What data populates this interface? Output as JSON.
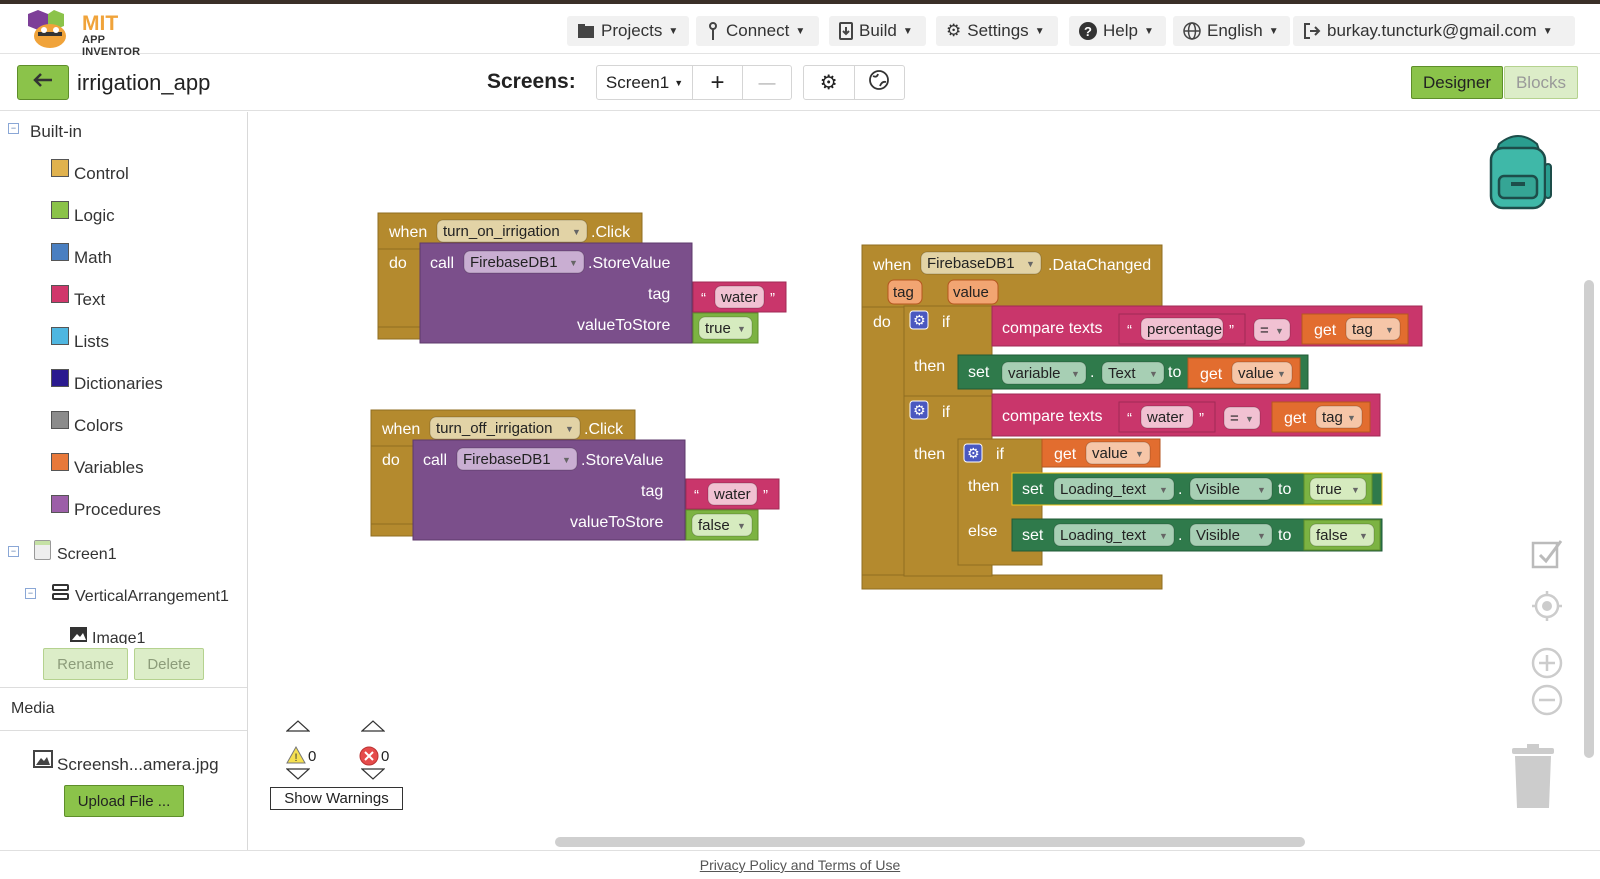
{
  "app": {
    "logo_line1": "MIT",
    "logo_line2": "APP INVENTOR"
  },
  "nav": {
    "projects": "Projects",
    "connect": "Connect",
    "build": "Build",
    "settings": "Settings",
    "help": "Help",
    "language": "English",
    "account": "burkay.tuncturk@gmail.com"
  },
  "toolbar": {
    "project_name": "irrigation_app",
    "screens_label": "Screens:",
    "screen_select": "Screen1",
    "add": "+",
    "remove": "—",
    "designer": "Designer",
    "blocks": "Blocks"
  },
  "sidebar": {
    "builtin": "Built-in",
    "categories": [
      {
        "label": "Control",
        "color": "#e0b24e"
      },
      {
        "label": "Logic",
        "color": "#8bc34a"
      },
      {
        "label": "Math",
        "color": "#4a7fc1"
      },
      {
        "label": "Text",
        "color": "#d0376b"
      },
      {
        "label": "Lists",
        "color": "#4fb6e0"
      },
      {
        "label": "Dictionaries",
        "color": "#2a1a8f"
      },
      {
        "label": "Colors",
        "color": "#8c8c8c"
      },
      {
        "label": "Variables",
        "color": "#e8793a"
      },
      {
        "label": "Procedures",
        "color": "#9c5fa8"
      }
    ],
    "screen": "Screen1",
    "arrangement": "VerticalArrangement1",
    "image": "Image1",
    "rename": "Rename",
    "delete": "Delete",
    "media_label": "Media",
    "media_file": "Screensh...amera.jpg",
    "upload": "Upload File ..."
  },
  "blocks": {
    "b1": {
      "when": "when",
      "component": "turn_on_irrigation",
      "event": ".Click",
      "do": "do",
      "call": "call",
      "db": "FirebaseDB1",
      "method": ".StoreValue",
      "tag_label": "tag",
      "tag_value": "water",
      "vts_label": "valueToStore",
      "vts_value": "true"
    },
    "b2": {
      "when": "when",
      "component": "turn_off_irrigation",
      "event": ".Click",
      "do": "do",
      "call": "call",
      "db": "FirebaseDB1",
      "method": ".StoreValue",
      "tag_label": "tag",
      "tag_value": "water",
      "vts_label": "valueToStore",
      "vts_value": "false"
    },
    "b3": {
      "when": "when",
      "component": "FirebaseDB1",
      "event": ".DataChanged",
      "param_tag": "tag",
      "param_value": "value",
      "do": "do",
      "if1": "if",
      "compare1": "compare texts",
      "str1": "percentage",
      "op1": "=",
      "get1": "get",
      "get1v": "tag",
      "then1": "then",
      "set1": "set",
      "set1comp": "variable",
      "dot": ".",
      "set1prop": "Text",
      "to": "to",
      "get2": "get",
      "get2v": "value",
      "if2": "if",
      "compare2": "compare texts",
      "str2": "water",
      "op2": "=",
      "get3": "get",
      "get3v": "tag",
      "then2": "then",
      "if3": "if",
      "get4": "get",
      "get4v": "value",
      "then3": "then",
      "set2": "set",
      "set2comp": "Loading_text",
      "set2prop": "Visible",
      "set2val": "true",
      "else": "else",
      "set3": "set",
      "set3comp": "Loading_text",
      "set3prop": "Visible",
      "set3val": "false"
    }
  },
  "warnings": {
    "warn_count": "0",
    "error_count": "0",
    "show_warnings": "Show Warnings"
  },
  "footer": {
    "privacy": "Privacy Policy and Terms of Use"
  }
}
